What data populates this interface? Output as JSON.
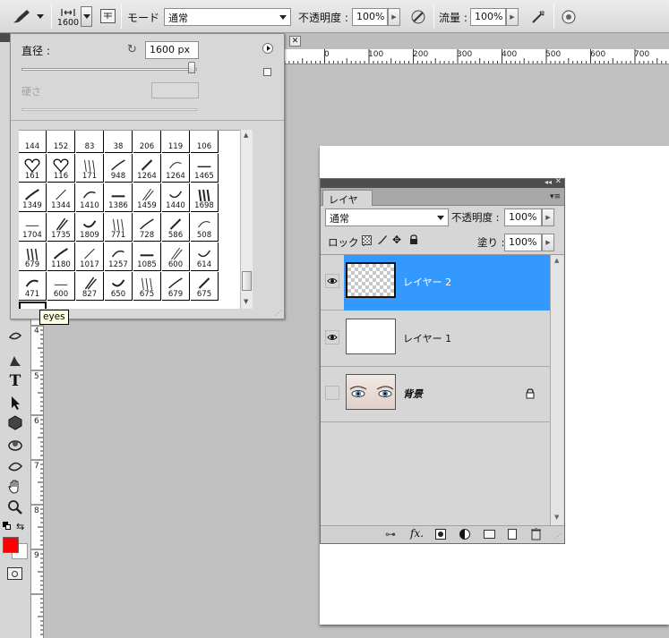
{
  "options_bar": {
    "brush_size": "1600",
    "mode_label": "モード :",
    "mode_value": "通常",
    "opacity_label": "不透明度 :",
    "opacity_value": "100%",
    "flow_label": "流量 :",
    "flow_value": "100%"
  },
  "brush_popup": {
    "diameter_label": "直径 :",
    "diameter_value": "1600 px",
    "diameter_slider_fraction": 1.0,
    "hardness_label": "硬さ",
    "hardness_value": "",
    "presets": [
      [
        "144",
        "152",
        "83",
        "38",
        "206",
        "119",
        "106"
      ],
      [
        "161",
        "116",
        "171",
        "948",
        "1264",
        "1264",
        "1465"
      ],
      [
        "1349",
        "1344",
        "1410",
        "1386",
        "1459",
        "1440",
        "1698"
      ],
      [
        "1704",
        "1735",
        "1809",
        "771",
        "728",
        "586",
        "508"
      ],
      [
        "679",
        "1180",
        "1017",
        "1257",
        "1085",
        "600",
        "614"
      ],
      [
        "471",
        "600",
        "827",
        "650",
        "675",
        "679",
        "675"
      ],
      [
        "1600"
      ]
    ],
    "tooltip": "eyes"
  },
  "ruler": {
    "h_labels": [
      "0",
      "100",
      "200",
      "300",
      "400",
      "500",
      "600",
      "700"
    ],
    "v_labels": [
      "4",
      "5",
      "6",
      "7",
      "8",
      "9"
    ]
  },
  "layers_panel": {
    "tab_label": "レイヤー",
    "blend_mode": "通常",
    "opacity_label": "不透明度 :",
    "opacity_value": "100%",
    "lock_label": "ロック :",
    "fill_label": "塗り :",
    "fill_value": "100%",
    "layers": [
      {
        "name": "レイヤー 2",
        "visible": true,
        "selected": true
      },
      {
        "name": "レイヤー 1",
        "visible": true,
        "selected": false
      },
      {
        "name": "背景",
        "visible": false,
        "selected": false,
        "locked": true
      }
    ]
  },
  "colors": {
    "foreground": "#ff0000",
    "background": "#ffffff",
    "selection": "#3399ff"
  }
}
